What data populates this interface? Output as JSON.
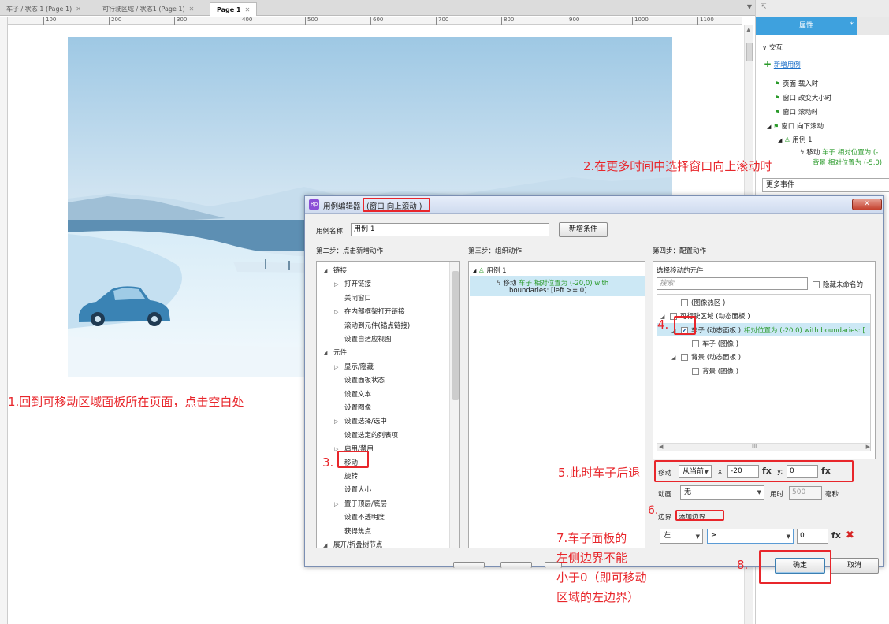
{
  "tabs": [
    {
      "label": "车子 / 状态 1 (Page 1)"
    },
    {
      "label": "可行驶区域 / 状态1 (Page 1)"
    },
    {
      "label": "Page 1"
    }
  ],
  "ruler_marks": [
    "100",
    "200",
    "300",
    "400",
    "500",
    "600",
    "700",
    "800",
    "900",
    "1000",
    "1100"
  ],
  "right_panel": {
    "tab_label": "属性",
    "section": "交互",
    "add_case": "新增用例",
    "events": [
      "页面 载入时",
      "窗口 改变大小时",
      "窗口 滚动时",
      "窗口 向下滚动"
    ],
    "case_label": "用例 1",
    "action_line1_prefix": "移动",
    "action_line1_green": "车子 相对位置为 (-",
    "action_line2_green": "背景 相对位置为 (-5,0)",
    "more_events": "更多事件"
  },
  "dialog": {
    "title": "用例编辑器",
    "title_paren": "(窗口 向上滚动 )",
    "case_name_label": "用例名称",
    "case_name_value": "用例 1",
    "add_condition": "新增条件",
    "step2": "第二步：点击新增动作",
    "step3": "第三步：组织动作",
    "step4": "第四步：配置动作",
    "actions_tree": [
      {
        "label": "链接",
        "level": 0,
        "arrow": "◢"
      },
      {
        "label": "打开链接",
        "level": 1,
        "arrow": "▷"
      },
      {
        "label": "关闭窗口",
        "level": 1,
        "arrow": ""
      },
      {
        "label": "在内部框架打开链接",
        "level": 1,
        "arrow": "▷"
      },
      {
        "label": "滚动到元件(锚点链接)",
        "level": 1,
        "arrow": ""
      },
      {
        "label": "设置自适应视图",
        "level": 1,
        "arrow": ""
      },
      {
        "label": "元件",
        "level": 0,
        "arrow": "◢"
      },
      {
        "label": "显示/隐藏",
        "level": 1,
        "arrow": "▷"
      },
      {
        "label": "设置面板状态",
        "level": 1,
        "arrow": ""
      },
      {
        "label": "设置文本",
        "level": 1,
        "arrow": ""
      },
      {
        "label": "设置图像",
        "level": 1,
        "arrow": ""
      },
      {
        "label": "设置选择/选中",
        "level": 1,
        "arrow": "▷"
      },
      {
        "label": "设置选定的列表项",
        "level": 1,
        "arrow": ""
      },
      {
        "label": "启用/禁用",
        "level": 1,
        "arrow": "▷"
      },
      {
        "label": "移动",
        "level": 1,
        "arrow": ""
      },
      {
        "label": "旋转",
        "level": 1,
        "arrow": ""
      },
      {
        "label": "设置大小",
        "level": 1,
        "arrow": ""
      },
      {
        "label": "置于顶层/底层",
        "level": 1,
        "arrow": "▷"
      },
      {
        "label": "设置不透明度",
        "level": 1,
        "arrow": ""
      },
      {
        "label": "获得焦点",
        "level": 1,
        "arrow": ""
      },
      {
        "label": "展开/折叠树节点",
        "level": 0,
        "arrow": "◢"
      }
    ],
    "organize_case": "用例 1",
    "organize_action_prefix": "移动",
    "organize_action_green": "车子 相对位置为 (-20,0)  with",
    "organize_action_line2": "boundaries: [left >= 0]",
    "select_widgets_label": "选择移动的元件",
    "search_placeholder": "搜索",
    "hide_unnamed": "隐藏未命名的",
    "widget_tree": [
      {
        "label": "(图像热区 )",
        "level": 1,
        "arrow": "",
        "checked": false,
        "green": ""
      },
      {
        "label": "可行驶区域 (动态面板 )",
        "level": 0,
        "arrow": "◢",
        "checked": false,
        "green": ""
      },
      {
        "label": "车子 (动态面板 )",
        "level": 1,
        "arrow": "◢",
        "checked": true,
        "green": "相对位置为 (-20,0)  with boundaries: ["
      },
      {
        "label": "车子 (图像 )",
        "level": 2,
        "arrow": "",
        "checked": false,
        "green": ""
      },
      {
        "label": "背景 (动态面板 )",
        "level": 1,
        "arrow": "◢",
        "checked": false,
        "green": ""
      },
      {
        "label": "背景 (图像 )",
        "level": 2,
        "arrow": "",
        "checked": false,
        "green": ""
      }
    ],
    "move_label": "移动",
    "move_mode": "从当前",
    "x_label": "x:",
    "x_value": "-20",
    "y_label": "y:",
    "y_value": "0",
    "fx": "fx",
    "anim_label": "动画",
    "anim_value": "无",
    "time_label": "用时",
    "time_value": "500",
    "time_unit": "毫秒",
    "bounds_label": "边界",
    "add_bounds": "添加边界",
    "bound_side": "左",
    "bound_op": "≥",
    "bound_value": "0",
    "ok": "确定",
    "cancel": "取消"
  },
  "annotations": {
    "a1": "1.回到可移动区域面板所在页面，点击空白处",
    "a2": "2.在更多时间中选择窗口向上滚动时",
    "a3": "3.",
    "a4": "4.",
    "a5": "5.此时车子后退",
    "a6": "6.",
    "a7_l1": "7.车子面板的",
    "a7_l2": "左侧边界不能",
    "a7_l3": "小于0（即可移动",
    "a7_l4": "区域的左边界）",
    "a8": "8."
  },
  "colors": {
    "accent_blue": "#3ea1de",
    "annotation_red": "#e8262b",
    "action_green": "#2a9a2a"
  }
}
